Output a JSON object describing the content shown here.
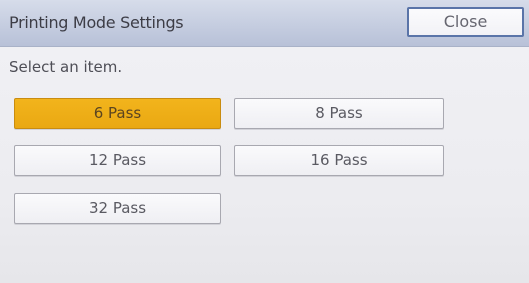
{
  "header": {
    "title": "Printing Mode Settings",
    "close_label": "Close"
  },
  "instruction": "Select an item.",
  "options": [
    {
      "label": "6 Pass",
      "selected": true
    },
    {
      "label": "8 Pass",
      "selected": false
    },
    {
      "label": "12 Pass",
      "selected": false
    },
    {
      "label": "16 Pass",
      "selected": false
    },
    {
      "label": "32 Pass",
      "selected": false
    }
  ],
  "colors": {
    "selected": "#f2b41c",
    "header": "#c5cde0",
    "close_border": "#5a74a8"
  }
}
